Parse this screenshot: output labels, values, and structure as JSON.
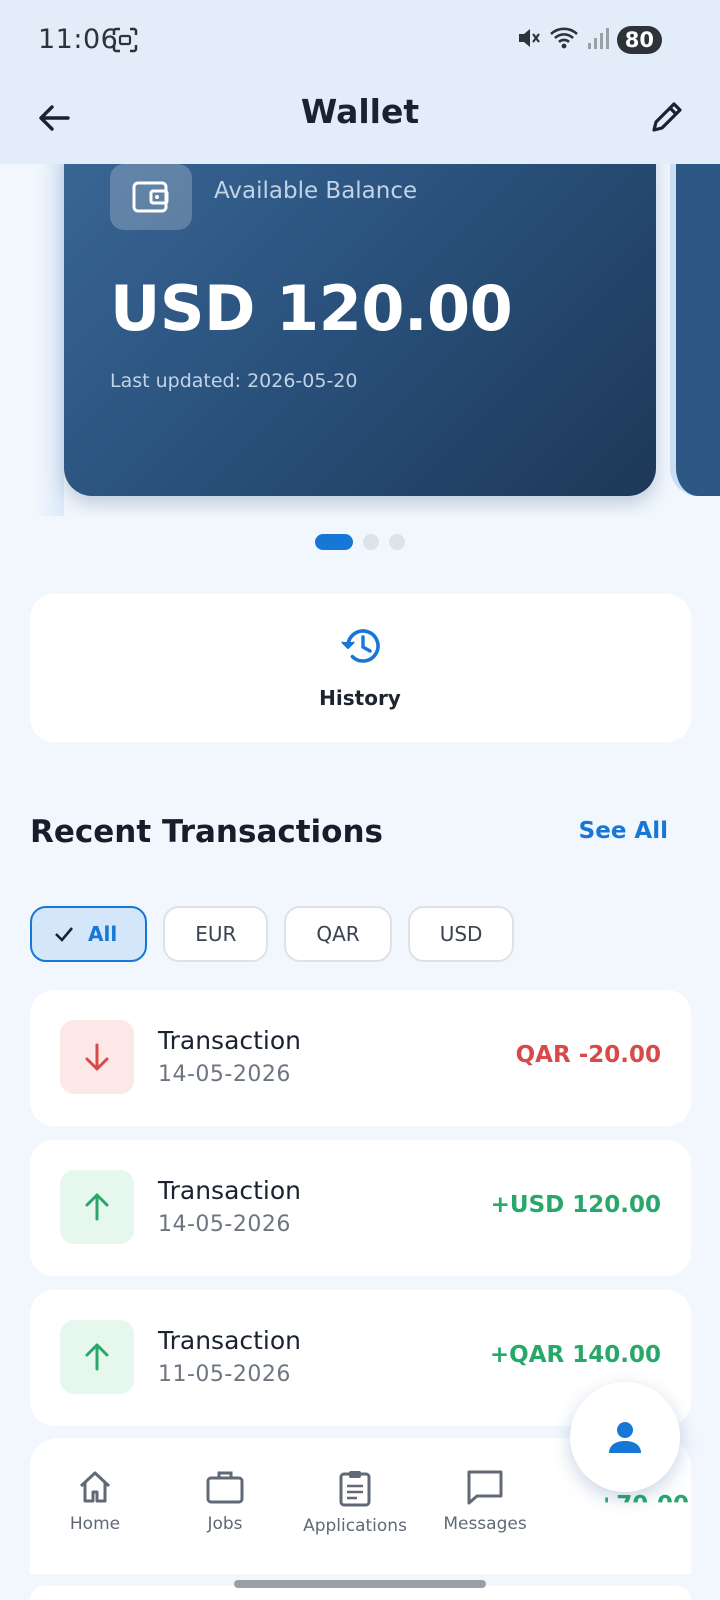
{
  "status_bar": {
    "time": "11:06",
    "battery": "80"
  },
  "app_bar": {
    "title": "Wallet"
  },
  "balance_card": {
    "label": "Available Balance",
    "amount": "USD 120.00",
    "last_updated": "Last updated: 2026-05-20"
  },
  "pager": {
    "total": 3,
    "active_index": 0
  },
  "history": {
    "label": "History"
  },
  "recent": {
    "title": "Recent Transactions",
    "see_all": "See All"
  },
  "filters": {
    "items": [
      "All",
      "EUR",
      "QAR",
      "USD"
    ],
    "selected": "All"
  },
  "transactions": [
    {
      "title": "Transaction",
      "date": "14-05-2026",
      "amount": "QAR -20.00",
      "direction": "out"
    },
    {
      "title": "Transaction",
      "date": "14-05-2026",
      "amount": "+USD 120.00",
      "direction": "in"
    },
    {
      "title": "Transaction",
      "date": "11-05-2026",
      "amount": "+QAR 140.00",
      "direction": "in"
    }
  ],
  "partial_transaction_amount": "+70.00",
  "bottom_nav": {
    "items": [
      "Home",
      "Jobs",
      "Applications",
      "Messages"
    ]
  },
  "colors": {
    "accent": "#1677d6",
    "positive": "#27a86a",
    "negative": "#d84a4a",
    "card_gradient_start": "#3a6796",
    "card_gradient_end": "#1d3857"
  },
  "icons": {
    "back": "arrow-left-icon",
    "edit": "pencil-icon",
    "wallet": "wallet-icon",
    "history": "history-icon",
    "outgoing": "arrow-down-icon",
    "incoming": "arrow-up-icon",
    "fab": "person-icon"
  }
}
